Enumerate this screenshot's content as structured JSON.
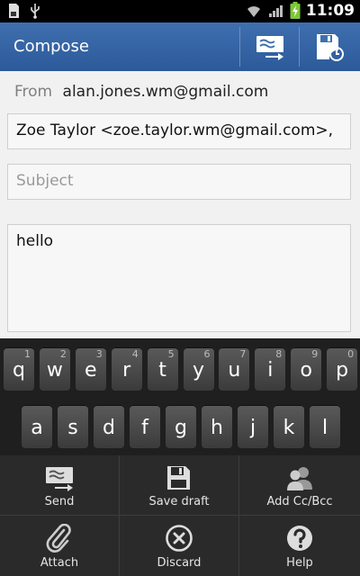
{
  "status_bar": {
    "time": "11:09"
  },
  "header": {
    "title": "Compose"
  },
  "compose": {
    "from_label": "From",
    "from_value": "alan.jones.wm@gmail.com",
    "to_value": "Zoe Taylor <zoe.taylor.wm@gmail.com>,",
    "subject_placeholder": "Subject",
    "body_text": "hello"
  },
  "keyboard": {
    "row1": [
      {
        "ch": "q",
        "num": "1"
      },
      {
        "ch": "w",
        "num": "2"
      },
      {
        "ch": "e",
        "num": "3"
      },
      {
        "ch": "r",
        "num": "4"
      },
      {
        "ch": "t",
        "num": "5"
      },
      {
        "ch": "y",
        "num": "6"
      },
      {
        "ch": "u",
        "num": "7"
      },
      {
        "ch": "i",
        "num": "8"
      },
      {
        "ch": "o",
        "num": "9"
      },
      {
        "ch": "p",
        "num": "0"
      }
    ],
    "row2": [
      {
        "ch": "a"
      },
      {
        "ch": "s"
      },
      {
        "ch": "d"
      },
      {
        "ch": "f"
      },
      {
        "ch": "g"
      },
      {
        "ch": "h"
      },
      {
        "ch": "j"
      },
      {
        "ch": "k"
      },
      {
        "ch": "l"
      }
    ]
  },
  "menu": [
    {
      "label": "Send",
      "icon": "send-icon"
    },
    {
      "label": "Save draft",
      "icon": "save-draft-icon"
    },
    {
      "label": "Add Cc/Bcc",
      "icon": "contacts-icon"
    },
    {
      "label": "Attach",
      "icon": "paperclip-icon"
    },
    {
      "label": "Discard",
      "icon": "discard-icon"
    },
    {
      "label": "Help",
      "icon": "help-icon"
    }
  ]
}
